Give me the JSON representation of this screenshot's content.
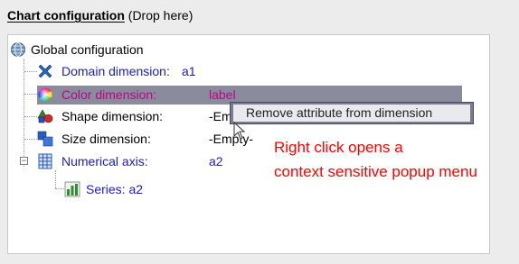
{
  "panel": {
    "title_bold": "Chart configuration",
    "title_rest": " (Drop here)"
  },
  "tree": {
    "root": {
      "label": "Global configuration",
      "icon": "globe-icon"
    },
    "items": [
      {
        "label": "Domain dimension:",
        "value": "a1",
        "icon": "cross-icon"
      },
      {
        "label": "Color dimension:",
        "value": "label",
        "icon": "color-wheel-icon"
      },
      {
        "label": "Shape dimension:",
        "value": "-Em",
        "icon": "shapes-icon"
      },
      {
        "label": "Size dimension:",
        "value": "-Empty-",
        "icon": "size-squares-icon"
      },
      {
        "label": "Numerical axis:",
        "value": "a2",
        "icon": "grid-axis-icon"
      }
    ],
    "child": {
      "label": "Series: a2",
      "icon": "bar-series-icon"
    }
  },
  "context_menu": {
    "item": "Remove attribute from dimension"
  },
  "annotation": {
    "line1": "Right click opens a",
    "line2": "context sensitive popup menu"
  },
  "colors": {
    "link_blue": "#1b1bd1",
    "magenta": "#c1008b",
    "annotation_red": "#ff0000",
    "selection": "#8b8b9e"
  }
}
